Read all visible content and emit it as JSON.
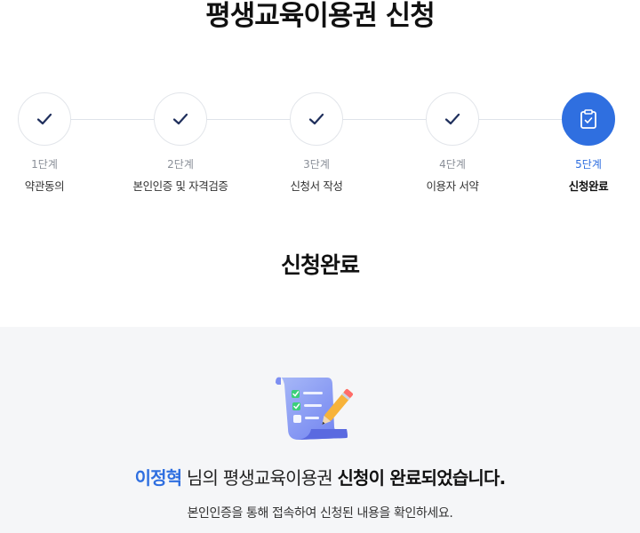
{
  "page_title": "평생교육이용권 신청",
  "steps": [
    {
      "number": "1단계",
      "label": "약관동의",
      "state": "done"
    },
    {
      "number": "2단계",
      "label": "본인인증 및 자격검증",
      "state": "done"
    },
    {
      "number": "3단계",
      "label": "신청서 작성",
      "state": "done"
    },
    {
      "number": "4단계",
      "label": "이용자 서약",
      "state": "done"
    },
    {
      "number": "5단계",
      "label": "신청완료",
      "state": "current"
    }
  ],
  "step_icons": {
    "done": "check-icon",
    "current": "clipboard-check-icon"
  },
  "section_title": "신청완료",
  "result": {
    "illustration": "document-checklist-pencil-icon",
    "user_name": "이정혁",
    "message_mid": " 님의 평생교육이용권 ",
    "message_bold": "신청이 완료되었습니다.",
    "sub_message": "본인인증을 통해 접속하여 신청된 내용을 확인하세요."
  },
  "colors": {
    "accent": "#2f6fe0",
    "check_mark": "#1f2f5c",
    "panel_bg": "#f5f6f8"
  }
}
